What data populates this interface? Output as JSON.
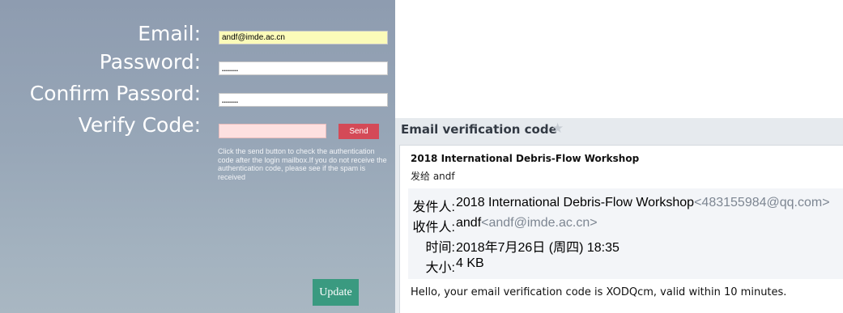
{
  "form": {
    "email_label": "Email:",
    "email_value": "andf@imde.ac.cn",
    "password_label": "Password:",
    "password_value": "........",
    "confirm_label": "Confirm Passord:",
    "confirm_value": "........",
    "verify_label": "Verify Code:",
    "verify_value": "",
    "send_label": "Send",
    "help_text": "Click the send button to check the authentication code after the login mailbox.If you do not receive the authentication code, please see if the spam is received",
    "update_label": "Update"
  },
  "mail": {
    "subject": "Email verification code",
    "from_name": "2018 International Debris-Flow Workshop",
    "sent_to": "发给 andf",
    "meta": {
      "from_label": "发件人:",
      "from_name": "2018 International Debris-Flow Workshop",
      "from_addr": "<483155984@qq.com>",
      "to_label": "收件人:",
      "to_name": "andf",
      "to_addr": "<andf@imde.ac.cn>",
      "time_label": "时间:",
      "time_value": "2018年7月26日 (周四) 18:35",
      "size_label": "大小:",
      "size_value": "4 KB"
    },
    "body": "Hello, your email verification code is XODQcm, valid within 10 minutes."
  },
  "icons": {
    "star": "star-icon"
  },
  "colors": {
    "send_button": "#d44a57",
    "update_button": "#3a9a80",
    "email_field_bg": "#fbfbb9",
    "verify_field_bg": "#fde0e0"
  }
}
